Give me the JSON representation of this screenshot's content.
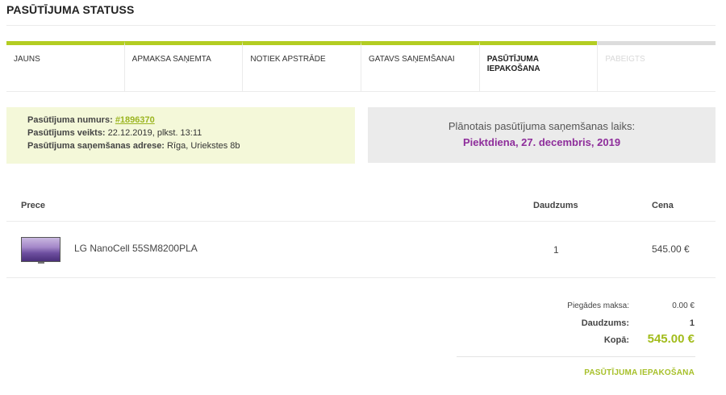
{
  "page": {
    "title": "PASŪTĪJUMA STATUSS"
  },
  "steps": [
    {
      "label": "JAUNS",
      "state": "done"
    },
    {
      "label": "APMAKSA SAŅEMTA",
      "state": "done"
    },
    {
      "label": "NOTIEK APSTRĀDE",
      "state": "done"
    },
    {
      "label": "GATAVS SAŅEMŠANAI",
      "state": "done"
    },
    {
      "label": "PASŪTĪJUMA IEPAKOŠANA",
      "state": "current"
    },
    {
      "label": "PABEIGTS",
      "state": "pending"
    }
  ],
  "order": {
    "number_label": "Pasūtījuma numurs:",
    "number": "#1896370",
    "placed_label": "Pasūtījums veikts:",
    "placed": "22.12.2019, plkst. 13:11",
    "address_label": "Pasūtījuma saņemšanas adrese:",
    "address": "Rīga, Uriekstes 8b"
  },
  "pickup": {
    "label": "Plānotais pasūtījuma saņemšanas laiks:",
    "date": "Piektdiena, 27. decembris, 2019"
  },
  "table": {
    "col_product": "Prece",
    "col_qty": "Daudzums",
    "col_price": "Cena",
    "rows": [
      {
        "name": "LG NanoCell 55SM8200PLA",
        "qty": "1",
        "price": "545.00 €"
      }
    ]
  },
  "summary": {
    "delivery_label": "Piegādes maksa:",
    "delivery_value": "0.00 €",
    "qty_label": "Daudzums:",
    "qty_value": "1",
    "total_label": "Kopā:",
    "total_value": "545.00 €",
    "status_link": "PASŪTĪJUMA IEPAKOŠANA"
  },
  "colors": {
    "accent_green": "#b3cd22",
    "pending_grey": "#dcdcdc",
    "date_purple": "#8e2d9b",
    "order_box_bg": "#f4f8d9",
    "pickup_box_bg": "#ebebeb"
  },
  "icons": {
    "product_thumbnail": "tv-product-image"
  }
}
